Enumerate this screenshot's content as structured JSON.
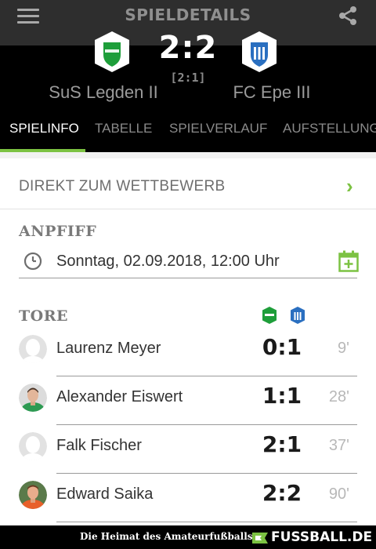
{
  "app": {
    "title": "SPIELDETAILS",
    "menu_icon": "hamburger-menu-icon",
    "share_icon": "share-icon"
  },
  "match": {
    "home_team": "SuS Legden II",
    "away_team": "FC Epe III",
    "score": "2:2",
    "halftime": "[2:1]",
    "home_crest_color": "#1e9e3a",
    "away_crest_color": "#2a6fc0"
  },
  "tabs": [
    {
      "label": "SPIELINFO",
      "active": true
    },
    {
      "label": "TABELLE",
      "active": false
    },
    {
      "label": "SPIELVERLAUF",
      "active": false
    },
    {
      "label": "AUFSTELLUNG",
      "active": false
    }
  ],
  "competition_link": {
    "label": "DIREKT ZUM WETTBEWERB",
    "icon": "chevron-right-icon"
  },
  "kickoff": {
    "title": "ANPFIFF",
    "datetime": "Sonntag, 02.09.2018, 12:00 Uhr",
    "clock_icon": "clock-icon",
    "calendar_icon": "calendar-add-icon"
  },
  "goals": {
    "title": "TORE",
    "items": [
      {
        "player": "Laurenz Meyer",
        "score": "0:1",
        "minute": "9'",
        "avatar": "placeholder"
      },
      {
        "player": "Alexander Eiswert",
        "score": "1:1",
        "minute": "28'",
        "avatar": "photo-green-jersey"
      },
      {
        "player": "Falk Fischer",
        "score": "2:1",
        "minute": "37'",
        "avatar": "placeholder"
      },
      {
        "player": "Edward Saika",
        "score": "2:2",
        "minute": "90'",
        "avatar": "photo-orange-jersey"
      }
    ]
  },
  "footer": {
    "tagline": "Die Heimat des Amateurfußballs",
    "brand": "FUSSBALL.DE"
  },
  "colors": {
    "accent": "#7cc242",
    "header_bg": "#2e2e2e",
    "match_bg": "#000000"
  }
}
